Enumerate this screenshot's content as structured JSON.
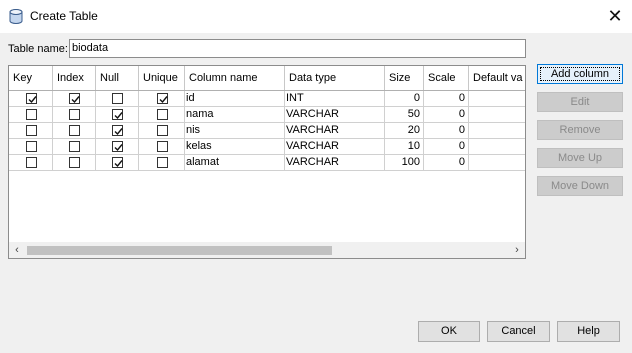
{
  "window": {
    "title": "Create Table",
    "close_glyph": "✕"
  },
  "table_name": {
    "label": "Table name:",
    "value": "biodata"
  },
  "columns_table": {
    "headers": [
      "Key",
      "Index",
      "Null",
      "Unique",
      "Column name",
      "Data type",
      "Size",
      "Scale",
      "Default va"
    ],
    "rows": [
      {
        "key": true,
        "index": true,
        "null": false,
        "unique": true,
        "name": "id",
        "type": "INT",
        "size": "0",
        "scale": "0",
        "default": ""
      },
      {
        "key": false,
        "index": false,
        "null": true,
        "unique": false,
        "name": "nama",
        "type": "VARCHAR",
        "size": "50",
        "scale": "0",
        "default": ""
      },
      {
        "key": false,
        "index": false,
        "null": true,
        "unique": false,
        "name": "nis",
        "type": "VARCHAR",
        "size": "20",
        "scale": "0",
        "default": ""
      },
      {
        "key": false,
        "index": false,
        "null": true,
        "unique": false,
        "name": "kelas",
        "type": "VARCHAR",
        "size": "10",
        "scale": "0",
        "default": ""
      },
      {
        "key": false,
        "index": false,
        "null": true,
        "unique": false,
        "name": "alamat",
        "type": "VARCHAR",
        "size": "100",
        "scale": "0",
        "default": ""
      }
    ],
    "scroll_left": "‹",
    "scroll_right": "›"
  },
  "side_buttons": {
    "add_column": "Add column",
    "edit": "Edit",
    "remove": "Remove",
    "move_up": "Move Up",
    "move_down": "Move Down"
  },
  "footer_buttons": {
    "ok": "OK",
    "cancel": "Cancel",
    "help": "Help"
  },
  "icons": {
    "title": "database-icon",
    "close": "close-icon"
  }
}
